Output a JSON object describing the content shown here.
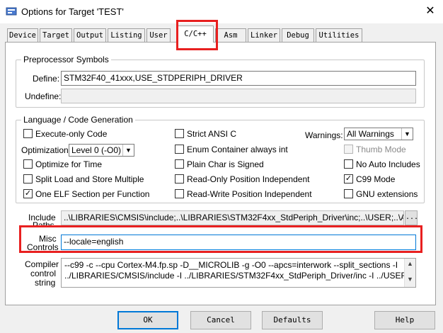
{
  "window": {
    "title": "Options for Target 'TEST'",
    "close_glyph": "✕"
  },
  "tabs": [
    {
      "label": "Device",
      "active": false
    },
    {
      "label": "Target",
      "active": false
    },
    {
      "label": "Output",
      "active": false
    },
    {
      "label": "Listing",
      "active": false
    },
    {
      "label": "User",
      "active": false
    },
    {
      "label": "C/C++",
      "active": true
    },
    {
      "label": "Asm",
      "active": false
    },
    {
      "label": "Linker",
      "active": false
    },
    {
      "label": "Debug",
      "active": false
    },
    {
      "label": "Utilities",
      "active": false
    }
  ],
  "preprocessor": {
    "group_title": "Preprocessor Symbols",
    "define_label": "Define:",
    "define_value": "STM32F40_41xxx,USE_STDPERIPH_DRIVER",
    "undefine_label": "Undefine:",
    "undefine_value": ""
  },
  "language": {
    "group_title": "Language / Code Generation",
    "execute_only": {
      "label": "Execute-only Code",
      "checked": false
    },
    "optimization_label": "Optimization:",
    "optimization_value": "Level 0 (-O0)",
    "optimize_time": {
      "label": "Optimize for Time",
      "checked": false
    },
    "split_load": {
      "label": "Split Load and Store Multiple",
      "checked": false
    },
    "one_elf": {
      "label": "One ELF Section per Function",
      "checked": true
    },
    "strict_ansi": {
      "label": "Strict ANSI C",
      "checked": false
    },
    "enum_container": {
      "label": "Enum Container always int",
      "checked": false
    },
    "plain_char": {
      "label": "Plain Char is Signed",
      "checked": false
    },
    "ro_pi": {
      "label": "Read-Only Position Independent",
      "checked": false
    },
    "rw_pi": {
      "label": "Read-Write Position Independent",
      "checked": false
    },
    "warnings_label": "Warnings:",
    "warnings_value": "All Warnings",
    "thumb_mode": {
      "label": "Thumb Mode",
      "checked": false,
      "disabled": true
    },
    "no_auto_includes": {
      "label": "No Auto Includes",
      "checked": false
    },
    "c99_mode": {
      "label": "C99 Mode",
      "checked": true
    },
    "gnu_extensions": {
      "label": "GNU extensions",
      "checked": false
    }
  },
  "paths": {
    "include_label_line1": "Include",
    "include_label_line2": "Paths",
    "include_value": "..\\LIBRARIES\\CMSIS\\include;..\\LIBRARIES\\STM32F4xx_StdPeriph_Driver\\inc;..\\USER;..\\APP;..\\F",
    "browse_label": "...",
    "misc_label_line1": "Misc",
    "misc_label_line2": "Controls",
    "misc_value": "--locale=english",
    "compiler_label_line1": "Compiler",
    "compiler_label_line2": "control",
    "compiler_label_line3": "string",
    "compiler_line1": "--c99 -c --cpu Cortex-M4.fp.sp -D__MICROLIB -g -O0 --apcs=interwork --split_sections -I",
    "compiler_line2": "../LIBRARIES/CMSIS/include -I ../LIBRARIES/STM32F4xx_StdPeriph_Driver/inc -I ../USER -I"
  },
  "buttons": {
    "ok": "OK",
    "cancel": "Cancel",
    "defaults": "Defaults",
    "help": "Help"
  },
  "glyphs": {
    "check": "✓",
    "dropdown": "▼",
    "scroll_up": "▲",
    "scroll_down": "▼"
  },
  "colors": {
    "highlight": "#e82020",
    "focus": "#0078d7"
  }
}
